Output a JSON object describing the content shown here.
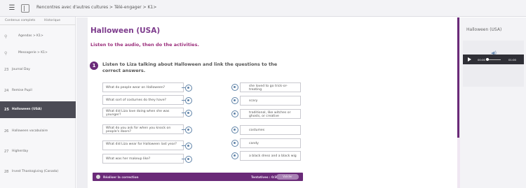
{
  "topbar": {
    "menu_icon": "hamburger-icon",
    "grid_icon": "sidebar-toggle-icon",
    "breadcrumb": "Rencontres avec d'autres cultures > Télé-engager > K1>"
  },
  "sidebar": {
    "tabs": [
      "Contenus complets",
      "Historique"
    ],
    "items": [
      {
        "num": "⚲",
        "label": "Agendas > K1>"
      },
      {
        "num": "⚲",
        "label": "Messagerie > K1>"
      },
      {
        "num": "23",
        "label": "Journal Day"
      },
      {
        "num": "24",
        "label": "Remise Pupil"
      },
      {
        "num": "25",
        "label": "Halloween (USA)"
      },
      {
        "num": "26",
        "label": "Halloween vocabulaire"
      },
      {
        "num": "27",
        "label": "Higherday"
      },
      {
        "num": "28",
        "label": "Irvest Thanksgiving (Canada)"
      }
    ]
  },
  "main": {
    "title": "Halloween (USA)",
    "instruction": "Listen to the audio, then do the activities.",
    "activity_number": "1",
    "activity_text": "Listen to Liza talking about Halloween and link the questions to the correct answers.",
    "questions": [
      "What do people wear on Halloween?",
      "What sort of costumes do they have?",
      "What did Liza love doing when she was younger?",
      "What do you ask for when you knock on people's doors?",
      "What did Liza wear for Halloween last year?",
      "What was her makeup like?"
    ],
    "answers": [
      "she loved to go trick-or-treating",
      "scary",
      "traditional, like witches or ghosts, or creative",
      "costumes",
      "candy",
      "a black dress and a black wig"
    ],
    "footer": {
      "label": "Réaliser la correction",
      "score": "Tentatives : 0/3",
      "button": "Valider"
    }
  },
  "right_panel": {
    "title": "Halloween (USA)",
    "speaker_icon": "speaker-icon",
    "player": {
      "current_time": "00:00",
      "end_time": "01:00"
    }
  },
  "colors": {
    "accent": "#6a2a78",
    "title": "#7d3b8c",
    "link": "#5f83a8"
  }
}
